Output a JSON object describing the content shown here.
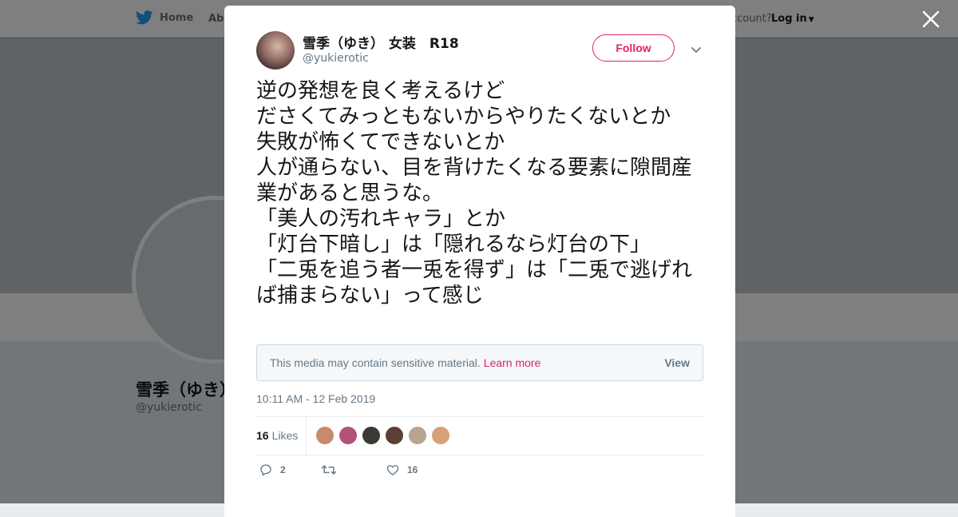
{
  "colors": {
    "brand": "#1da1f2",
    "accent": "#e0245e",
    "text": "#14171a",
    "muted": "#657786"
  },
  "topnav": {
    "home_label": "Home",
    "about_label": "Abo",
    "account_prompt": "ccount?",
    "login_label": "Log in"
  },
  "profile": {
    "name": "雪季（ゆき）",
    "handle": "@yukierotic"
  },
  "tweet": {
    "author_name": "雪季（ゆき） 女装　R18",
    "author_handle": "@yukierotic",
    "follow_label": "Follow",
    "text": "逆の発想を良く考えるけど\nださくてみっともないからやりたくないとか\n失敗が怖くてできないとか\n人が通らない、目を背けたくなる要素に隙間産業があると思うな。\n「美人の汚れキャラ」とか\n「灯台下暗し」は「隠れるなら灯台の下」\n「二兎を追う者一兎を得ず」は「二兎で逃げれば捕まらない」って感じ",
    "media_warning": "This media may contain sensitive material.",
    "learn_more_label": "Learn more",
    "view_label": "View",
    "timestamp": "10:11 AM - 12 Feb 2019",
    "likes_count": "16",
    "likes_label": "Likes",
    "likers": [
      {
        "color": "#c98a6b"
      },
      {
        "color": "#b5507a"
      },
      {
        "color": "#3b3b35"
      },
      {
        "color": "#5a4034"
      },
      {
        "color": "#b9a58e"
      },
      {
        "color": "#d7a07a"
      }
    ],
    "reply_count": "2",
    "retweet_count": "",
    "like_count": "16"
  },
  "icons": {
    "bird": "twitter-bird-icon",
    "close": "close-icon",
    "caret": "chevron-down-icon",
    "reply": "reply-icon",
    "retweet": "retweet-icon",
    "like": "heart-icon"
  }
}
